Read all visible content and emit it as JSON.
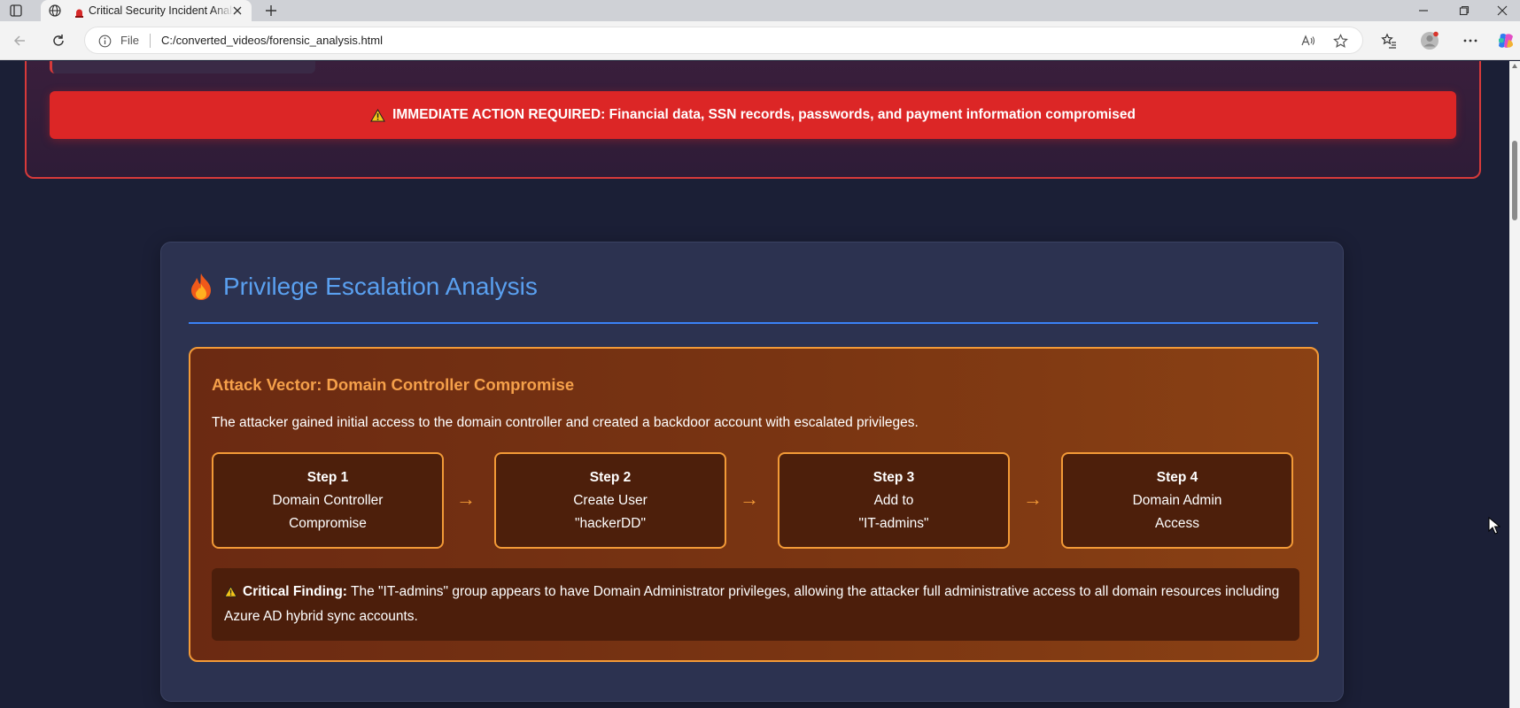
{
  "browser": {
    "tab_title": "Critical Security Incident Analysis",
    "url_scheme": "File",
    "url": "C:/converted_videos/forensic_analysis.html"
  },
  "page": {
    "banner": {
      "text": "IMMEDIATE ACTION REQUIRED: Financial data, SSN records, passwords, and payment information compromised"
    },
    "section": {
      "title": "Privilege Escalation Analysis",
      "vector_title": "Attack Vector: Domain Controller Compromise",
      "vector_desc": "The attacker gained initial access to the domain controller and created a backdoor account with escalated privileges.",
      "steps": [
        {
          "num": "Step 1",
          "line1": "Domain Controller",
          "line2": "Compromise"
        },
        {
          "num": "Step 2",
          "line1": "Create User",
          "line2": "\"hackerDD\""
        },
        {
          "num": "Step 3",
          "line1": "Add to",
          "line2": "\"IT-admins\""
        },
        {
          "num": "Step 4",
          "line1": "Domain Admin",
          "line2": "Access"
        }
      ],
      "arrow": "→",
      "finding_label": "Critical Finding:",
      "finding_text": " The \"IT-admins\" group appears to have Domain Administrator privileges, allowing the attacker full administrative access to all domain resources including Azure AD hybrid sync accounts."
    }
  },
  "colors": {
    "accent_red": "#dc2626",
    "accent_orange": "#f39a37",
    "accent_blue": "#5aa0f0",
    "page_bg": "#1b1f36"
  }
}
